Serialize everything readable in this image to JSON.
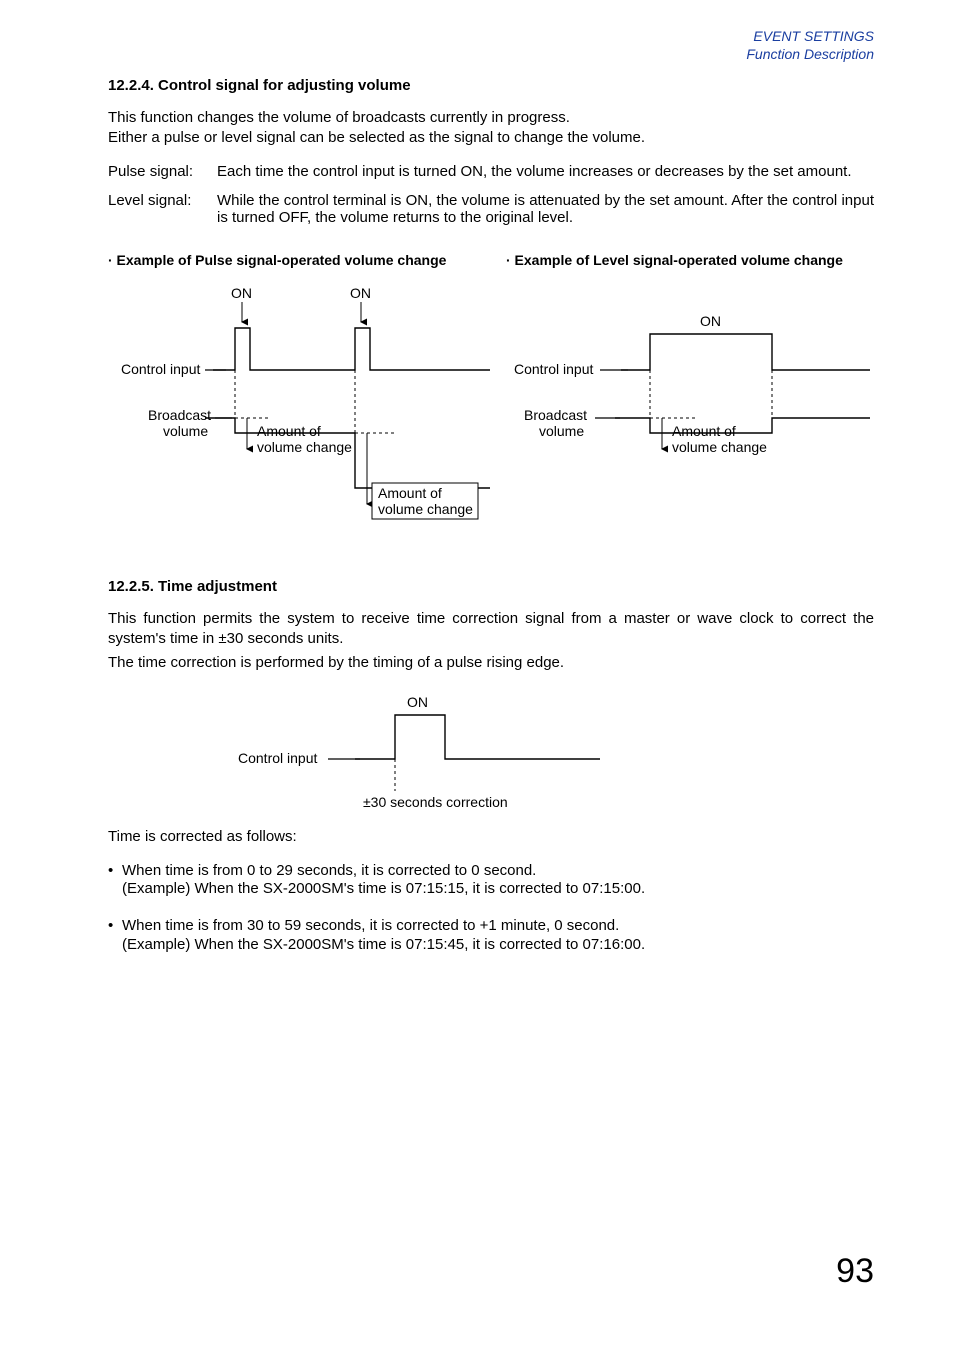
{
  "header": {
    "line1": "EVENT SETTINGS",
    "line2": "Function Description"
  },
  "sec1224": {
    "heading": "12.2.4. Control signal for adjusting volume",
    "intro1": "This function changes the volume of broadcasts currently in progress.",
    "intro2": "Either a pulse or level signal can be selected as the signal to change the volume.",
    "pulse_label": "Pulse signal:",
    "pulse_desc": "Each time the control input is turned ON, the volume increases or decreases by the set amount.",
    "level_label": "Level signal:",
    "level_desc": "While the control terminal is ON, the volume is attenuated by the set amount. After the control input is turned OFF, the volume returns to the original level.",
    "ex_pulse_title": "· Example of Pulse signal-operated volume change",
    "ex_level_title": "· Example of Level signal-operated volume change",
    "labels": {
      "on": "ON",
      "control_input": "Control input",
      "broadcast": "Broadcast",
      "volume": "volume",
      "amount_of": "Amount of",
      "volume_change": "volume change"
    }
  },
  "sec1225": {
    "heading": "12.2.5. Time adjustment",
    "para1": "This function permits the system to receive time correction signal from a master or wave clock to correct the system's time in ±30 seconds units.",
    "para2": "The time correction is performed by the timing of a pulse rising edge.",
    "labels": {
      "on": "ON",
      "control_input": "Control input",
      "correction": "±30 seconds correction"
    },
    "follows": "Time is corrected as follows:",
    "b1_line1": "When time is from 0 to 29 seconds, it is corrected to 0 second.",
    "b1_line2": "(Example) When the SX-2000SM's time is 07:15:15, it is corrected to 07:15:00.",
    "b2_line1": "When time is from 30 to 59 seconds, it is corrected to +1 minute, 0 second.",
    "b2_line2": "(Example) When the SX-2000SM's time is 07:15:45, it is corrected to 07:16:00."
  },
  "page_number": "93"
}
